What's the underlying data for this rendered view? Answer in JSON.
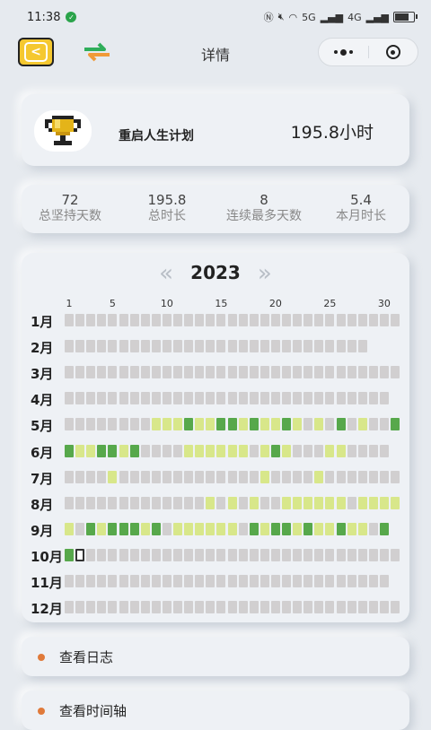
{
  "status_bar": {
    "time": "11:38",
    "network": "5G",
    "network2": "4G"
  },
  "header": {
    "title": "详情",
    "back_icon": "back-arrow-icon",
    "swap_icon": "swap-arrows-icon"
  },
  "plan": {
    "name": "重启人生计划",
    "hours": "195.8小时",
    "avatar_icon": "trophy-icon"
  },
  "stats": [
    {
      "value": "72",
      "label": "总坚持天数"
    },
    {
      "value": "195.8",
      "label": "总时长"
    },
    {
      "value": "8",
      "label": "连续最多天数"
    },
    {
      "value": "5.4",
      "label": "本月时长"
    }
  ],
  "calendar": {
    "year": "2023",
    "prev_icon": "«",
    "next_icon": "»",
    "day_ticks": [
      "1",
      "5",
      "10",
      "15",
      "20",
      "25",
      "30"
    ],
    "months": [
      "1月",
      "2月",
      "3月",
      "4月",
      "5月",
      "6月",
      "7月",
      "8月",
      "9月",
      "10月",
      "11月",
      "12月"
    ],
    "days_in_month": [
      31,
      28,
      31,
      30,
      31,
      30,
      31,
      31,
      30,
      31,
      30,
      31
    ],
    "colors": {
      "empty": "#d1cfd0",
      "light": "#d8e78a",
      "dark": "#57a84b",
      "today": "#ffffff"
    },
    "activity": {
      "5": {
        "9": "L",
        "10": "L",
        "11": "L",
        "12": "D",
        "13": "L",
        "14": "L",
        "15": "D",
        "16": "D",
        "17": "L",
        "18": "D",
        "19": "L",
        "20": "L",
        "21": "D",
        "22": "L",
        "24": "L",
        "26": "D",
        "28": "L",
        "31": "D"
      },
      "6": {
        "1": "D",
        "2": "L",
        "3": "L",
        "4": "D",
        "5": "D",
        "6": "L",
        "7": "D",
        "12": "L",
        "13": "L",
        "14": "L",
        "15": "L",
        "16": "L",
        "17": "L",
        "19": "L",
        "20": "D",
        "21": "L",
        "25": "L",
        "26": "L"
      },
      "7": {
        "5": "L",
        "19": "L",
        "24": "L"
      },
      "8": {
        "14": "L",
        "16": "L",
        "18": "L",
        "21": "L",
        "22": "L",
        "23": "L",
        "24": "L",
        "25": "L",
        "26": "L",
        "28": "L",
        "29": "L",
        "30": "L",
        "31": "L"
      },
      "9": {
        "1": "L",
        "3": "D",
        "4": "L",
        "5": "D",
        "6": "D",
        "7": "D",
        "8": "L",
        "9": "D",
        "11": "L",
        "12": "L",
        "13": "L",
        "14": "L",
        "15": "L",
        "16": "L",
        "18": "D",
        "19": "L",
        "20": "D",
        "21": "D",
        "22": "L",
        "23": "D",
        "24": "L",
        "25": "L",
        "26": "D",
        "27": "L",
        "28": "L",
        "30": "D"
      },
      "10": {
        "1": "D",
        "2": "T"
      }
    }
  },
  "actions": [
    {
      "label": "查看日志"
    },
    {
      "label": "查看时间轴"
    }
  ]
}
